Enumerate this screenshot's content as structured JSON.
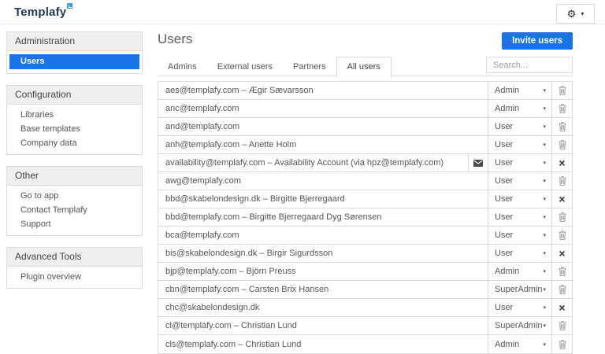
{
  "colors": {
    "accent_blue": "#1a73e8",
    "logo_navy": "#1e3b55",
    "badge_blue": "#2d9cf4",
    "border_gray": "#dcdcdc",
    "section_header_bg": "#efefef",
    "text_gray": "#555555"
  },
  "icons": {
    "gear": "⚙",
    "caret_down": "▾",
    "remove_x": "×"
  },
  "header": {
    "logo": "Templafy"
  },
  "sidebar": {
    "sections": [
      {
        "title": "Administration",
        "items": [
          {
            "label": "Users",
            "active": true
          }
        ]
      },
      {
        "title": "Configuration",
        "items": [
          {
            "label": "Libraries"
          },
          {
            "label": "Base templates"
          },
          {
            "label": "Company data"
          }
        ]
      },
      {
        "title": "Other",
        "items": [
          {
            "label": "Go to app"
          },
          {
            "label": "Contact Templafy"
          },
          {
            "label": "Support"
          }
        ]
      },
      {
        "title": "Advanced Tools",
        "items": [
          {
            "label": "Plugin overview"
          }
        ]
      }
    ]
  },
  "main": {
    "title": "Users",
    "invite_button": "Invite users",
    "search_placeholder": "Search...",
    "tabs": [
      {
        "label": "Admins"
      },
      {
        "label": "External users"
      },
      {
        "label": "Partners"
      },
      {
        "label": "All users",
        "active": true
      }
    ],
    "users_table": {
      "rows": [
        {
          "email": "aes@templafy.com – Ægir Sævarsson",
          "role": "Admin",
          "action": "delete"
        },
        {
          "email": "anc@templafy.com",
          "role": "Admin",
          "action": "delete"
        },
        {
          "email": "and@templafy.com",
          "role": "User",
          "action": "delete"
        },
        {
          "email": "anh@templafy.com – Anette Holm",
          "role": "User",
          "action": "delete"
        },
        {
          "email": "availability@templafy.com – Availability Account (via hpz@templafy.com)",
          "envelope": true,
          "role": "User",
          "action": "remove"
        },
        {
          "email": "awg@templafy.com",
          "role": "User",
          "action": "delete"
        },
        {
          "email": "bbd@skabelondesign.dk – Birgitte Bjerregaard",
          "role": "User",
          "action": "remove"
        },
        {
          "email": "bbd@templafy.com – Birgitte Bjerregaard Dyg Sørensen",
          "role": "User",
          "action": "delete"
        },
        {
          "email": "bca@templafy.com",
          "role": "User",
          "action": "delete"
        },
        {
          "email": "bis@skabelondesign.dk – Birgir Sigurdsson",
          "role": "User",
          "action": "remove"
        },
        {
          "email": "bjp@templafy.com – Björn Preuss",
          "role": "Admin",
          "action": "delete"
        },
        {
          "email": "cbn@templafy.com – Carsten Brix Hansen",
          "role": "SuperAdmin",
          "action": "delete"
        },
        {
          "email": "chc@skabelondesign.dk",
          "role": "User",
          "action": "remove"
        },
        {
          "email": "cl@templafy.com – Christian Lund",
          "role": "SuperAdmin",
          "action": "delete"
        },
        {
          "email": "cls@templafy.com – Christian Lund",
          "role": "Admin",
          "action": "delete"
        }
      ]
    }
  }
}
